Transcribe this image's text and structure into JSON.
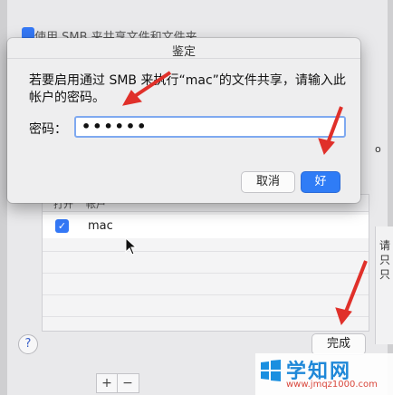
{
  "background": {
    "top_text": "使用 SMB 来共享文件和文件夹",
    "table": {
      "columns": [
        "打开",
        "帐户"
      ],
      "rows": [
        {
          "checked": true,
          "account": "mac"
        }
      ]
    },
    "side_items": [
      "请",
      "只",
      "只"
    ],
    "side_top": "o",
    "help_label": "?",
    "done_label": "完成",
    "plus_label": "+",
    "minus_label": "−"
  },
  "dialog": {
    "title": "鉴定",
    "message": "若要启用通过 SMB 来执行“mac”的文件共享，请输入此帐户的密码。",
    "password_label": "密码：",
    "password_value": "••••••",
    "cancel_label": "取消",
    "ok_label": "好"
  },
  "watermark": {
    "title": "学知网",
    "url": "www.jmqz1000.com"
  },
  "colors": {
    "accent": "#2f7cf6",
    "annotation": "#e0302a"
  }
}
